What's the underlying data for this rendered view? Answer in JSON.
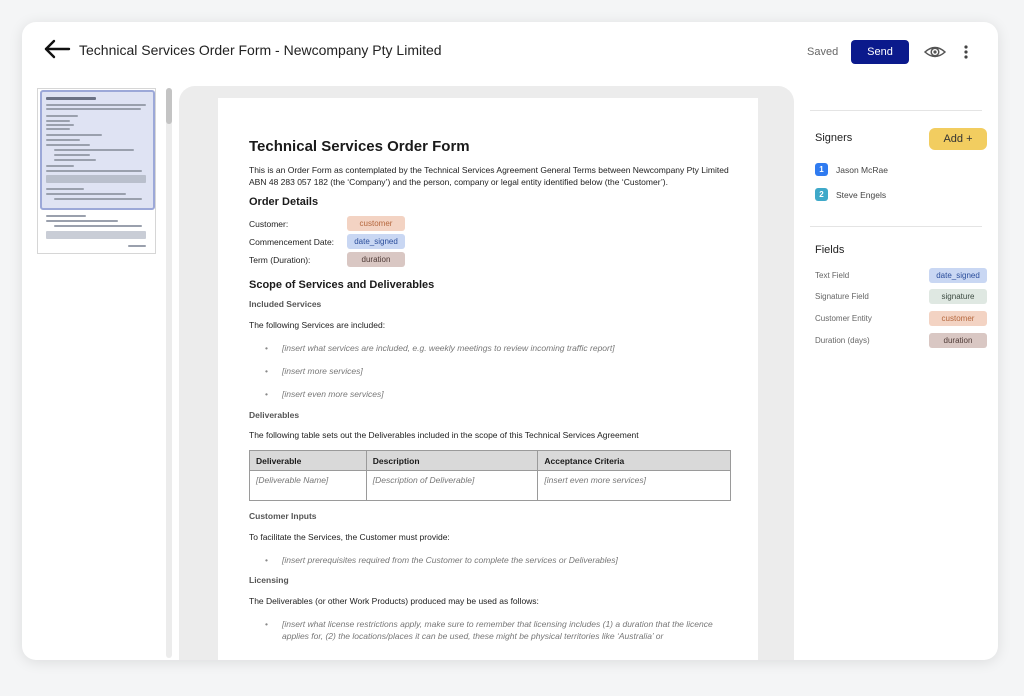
{
  "header": {
    "title": "Technical Services Order Form - Newcompany Pty Limited",
    "saved_label": "Saved",
    "send_label": "Send"
  },
  "colors": {
    "send_button": "#0b1a8c",
    "add_button": "#f2cd60",
    "signer_1": "#2f7bf0",
    "signer_2": "#3fa9c9",
    "tag_customer": "#f3d3c3",
    "tag_date": "#c9d7f3",
    "tag_duration": "#d9c7c3",
    "tag_signature": "#dfe8e2"
  },
  "document": {
    "title": "Technical Services Order Form",
    "intro": "This is an Order Form as contemplated by the Technical Services Agreement General Terms between Newcompany Pty Limited ABN 48 283 057 182 (the ‘Company’) and the person, company or legal entity identified below (the ‘Customer’).",
    "order_details_heading": "Order Details",
    "details": [
      {
        "label": "Customer:",
        "tag": "customer"
      },
      {
        "label": "Commencement Date:",
        "tag": "date_signed"
      },
      {
        "label": "Term (Duration):",
        "tag": "duration"
      }
    ],
    "scope_heading": "Scope of Services and Deliverables",
    "included_heading": "Included Services",
    "included_intro": "The following Services are included:",
    "included_bullets": [
      "[insert what services are included, e.g. weekly meetings to review incoming traffic report]",
      "[insert more services]",
      "[insert even more services]"
    ],
    "deliverables_heading": "Deliverables",
    "deliverables_intro": "The following table sets out the Deliverables included in the scope of this Technical Services Agreement",
    "table": {
      "headers": [
        "Deliverable",
        "Description",
        "Acceptance Criteria"
      ],
      "rows": [
        [
          "[Deliverable Name]",
          "[Description of Deliverable]",
          "[insert even more services]"
        ]
      ]
    },
    "customer_inputs_heading": "Customer Inputs",
    "customer_inputs_intro": "To facilitate the Services, the Customer must provide:",
    "customer_inputs_bullets": [
      "[insert prerequisites required from the Customer to complete the services or Deliverables]"
    ],
    "licensing_heading": "Licensing",
    "licensing_intro": "The Deliverables (or other Work Products) produced may be used as follows:",
    "licensing_bullets": [
      "[insert what license restrictions apply, make sure to remember that licensing includes (1) a duration that the licence applies for, (2) the locations/places it can be used, these might be physical territories like ‘Australia’ or"
    ]
  },
  "panel": {
    "signers_title": "Signers",
    "add_label": "Add +",
    "signers": [
      {
        "number": "1",
        "name": "Jason McRae"
      },
      {
        "number": "2",
        "name": "Steve Engels"
      }
    ],
    "fields_title": "Fields",
    "fields": [
      {
        "label": "Text Field",
        "tag": "date_signed"
      },
      {
        "label": "Signature Field",
        "tag": "signature"
      },
      {
        "label": "Customer Entity",
        "tag": "customer"
      },
      {
        "label": "Duration (days)",
        "tag": "duration"
      }
    ]
  }
}
